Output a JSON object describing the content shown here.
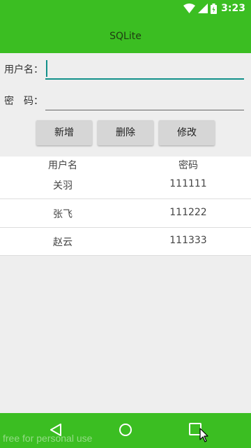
{
  "status_bar": {
    "time": "3:23"
  },
  "app_bar": {
    "title": "SQLite"
  },
  "form": {
    "username_label": "用户名：",
    "username_value": "",
    "password_label": "密　码：",
    "password_value": ""
  },
  "buttons": {
    "add": "新增",
    "delete": "删除",
    "modify": "修改"
  },
  "table": {
    "headers": [
      "用户名",
      "密码"
    ],
    "rows": [
      {
        "username": "关羽",
        "password": "111111"
      },
      {
        "username": "张飞",
        "password": "111222"
      },
      {
        "username": "赵云",
        "password": "111333"
      }
    ]
  },
  "nav_bar": {
    "back_icon": "back-triangle-icon",
    "home_icon": "home-circle-icon",
    "recents_icon": "recents-square-icon"
  },
  "watermark": "free for personal use",
  "colors": {
    "primary": "#3BBE22",
    "accent": "#12908A",
    "background": "#EEEEEE"
  }
}
